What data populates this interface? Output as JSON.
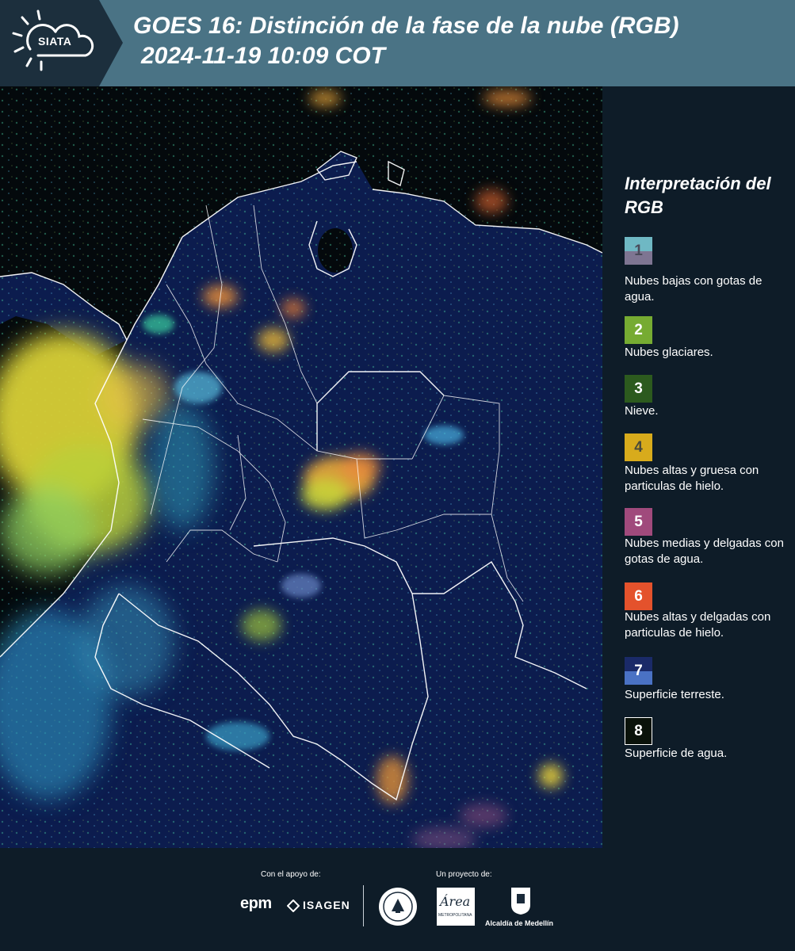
{
  "header": {
    "logo_text": "SIATA",
    "title_line1": "GOES 16: Distinción de la fase de la nube (RGB)",
    "title_line2": "2024-11-19 10:09 COT"
  },
  "legend": {
    "title": "Interpretación del RGB",
    "items": [
      {
        "number": "1",
        "label": "Nubes bajas con gotas de agua.",
        "color_top": "#6fb8c4",
        "color_bottom": "#7e7592",
        "text_color": "#4a4a5a"
      },
      {
        "number": "2",
        "label": "Nubes glaciares.",
        "color": "#76ab32"
      },
      {
        "number": "3",
        "label": "Nieve.",
        "color": "#2c5a1e"
      },
      {
        "number": "4",
        "label": "Nubes altas y gruesa con particulas de hielo.",
        "color": "#d8ab1c",
        "text_color": "#4a4a3a"
      },
      {
        "number": "5",
        "label": "Nubes medias y delgadas con gotas de agua.",
        "color": "#a04a7c"
      },
      {
        "number": "6",
        "label": "Nubes altas y delgadas con particulas de hielo.",
        "color": "#e4522c"
      },
      {
        "number": "7",
        "label": "Superficie terreste.",
        "color_top": "#1a2a68",
        "color_bottom": "#4a72c4"
      },
      {
        "number": "8",
        "label": "Superficie de agua.",
        "color": "#0a120a",
        "border": "#ffffff"
      }
    ]
  },
  "footer": {
    "support_label": "Con el apoyo de:",
    "project_label": "Un proyecto de:",
    "sponsor_epm": "epm",
    "sponsor_isagen": "ISAGEN",
    "area_metro_word": "Área",
    "area_metro_caption": "METROPOLITANA",
    "alcaldia": "Alcaldía de Medellín"
  },
  "colors": {
    "header_bg": "#4a7385",
    "logo_band": "#1c2f3d",
    "page_bg": "#0e1c28",
    "ocean": "#050a0e",
    "land": "#0d1e52",
    "cloud_yellow": "#d9d23a",
    "cloud_orange": "#e0903a",
    "cloud_cyan": "#3aa8c8",
    "cloud_green": "#2fd88a"
  }
}
